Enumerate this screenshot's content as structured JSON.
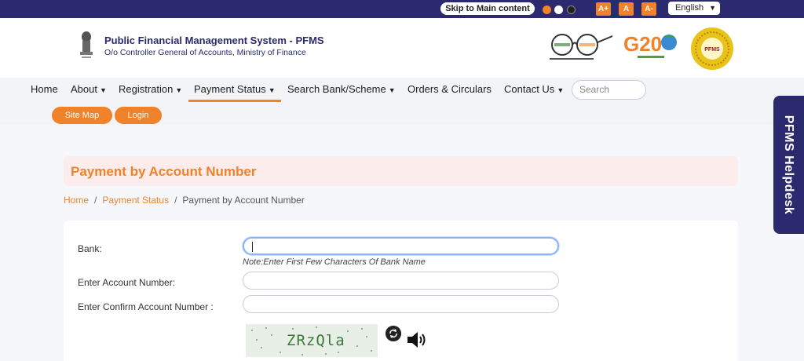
{
  "topbar": {
    "skip_label": "Skip to Main content",
    "font_increase": "A+",
    "font_normal": "A",
    "font_decrease": "A-",
    "language": "English"
  },
  "header": {
    "title": "Public Financial Management System - PFMS",
    "subtitle": "O/o Controller General of Accounts, Ministry of Finance",
    "g20_label": "G20",
    "seal_label": "PFMS"
  },
  "nav": {
    "items": [
      {
        "label": "Home"
      },
      {
        "label": "About"
      },
      {
        "label": "Registration"
      },
      {
        "label": "Payment Status"
      },
      {
        "label": "Search Bank/Scheme"
      },
      {
        "label": "Orders & Circulars"
      },
      {
        "label": "Contact Us"
      }
    ],
    "search_placeholder": "Search",
    "site_map": "Site Map",
    "login": "Login"
  },
  "main": {
    "page_title": "Payment by Account Number",
    "breadcrumb": [
      "Home",
      "Payment Status",
      "Payment by Account Number"
    ],
    "form": {
      "bank_label": "Bank:",
      "bank_value": "",
      "note": "Note:Enter First Few Characters Of Bank Name",
      "account_label": "Enter Account Number:",
      "account_value": "",
      "confirm_label": "Enter Confirm Account Number :",
      "confirm_value": "",
      "captcha_text": "ZRzQla"
    }
  },
  "helpdesk": {
    "label": "PFMS Helpdesk"
  },
  "colors": {
    "primary": "#2b2a6e",
    "accent": "#f0822a",
    "title_bg": "#fdecec"
  }
}
